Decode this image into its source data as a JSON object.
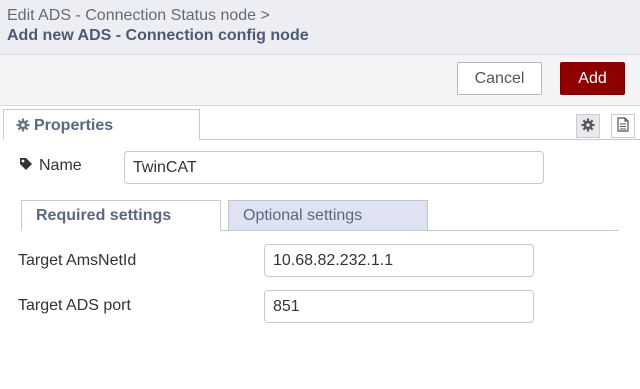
{
  "header": {
    "breadcrumb": "Edit ADS - Connection Status node >",
    "title": "Add new ADS - Connection config node"
  },
  "toolbar": {
    "cancel_label": "Cancel",
    "add_label": "Add"
  },
  "tabs": {
    "properties_label": "Properties"
  },
  "form": {
    "name_label": "Name",
    "name_value": "TwinCAT",
    "subtabs": {
      "required_label": "Required settings",
      "optional_label": "Optional settings"
    },
    "target_amsnetid_label": "Target AmsNetId",
    "target_amsnetid_value": "10.68.82.232.1.1",
    "target_ads_port_label": "Target ADS port",
    "target_ads_port_value": "851"
  },
  "colors": {
    "add_button": "#8f0000",
    "title_text": "#4d5a73",
    "inactive_tab": "#dfe3f1"
  },
  "icons": [
    "gear-icon",
    "tag-icon",
    "document-icon"
  ]
}
